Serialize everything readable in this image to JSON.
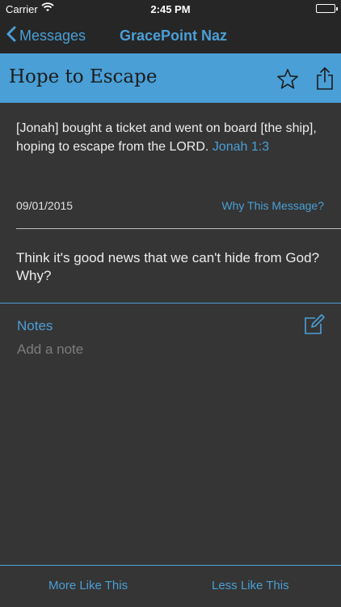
{
  "status_bar": {
    "carrier": "Carrier",
    "time": "2:45 PM"
  },
  "nav": {
    "back_label": "Messages",
    "title": "GracePoint Naz"
  },
  "message": {
    "title": "Hope to Escape",
    "verse_text": "[Jonah] bought a ticket and went on board [the ship], hoping to escape from the LORD. ",
    "verse_ref": "Jonah 1:3",
    "date": "09/01/2015",
    "why_label": "Why This Message?",
    "question": "Think it's good news that we can't hide from God? Why?"
  },
  "notes": {
    "label": "Notes",
    "placeholder": "Add a note"
  },
  "bottom": {
    "more_label": "More Like This",
    "less_label": "Less Like This"
  },
  "colors": {
    "accent": "#4a9fd6",
    "background": "#353535",
    "bar": "#262626"
  }
}
